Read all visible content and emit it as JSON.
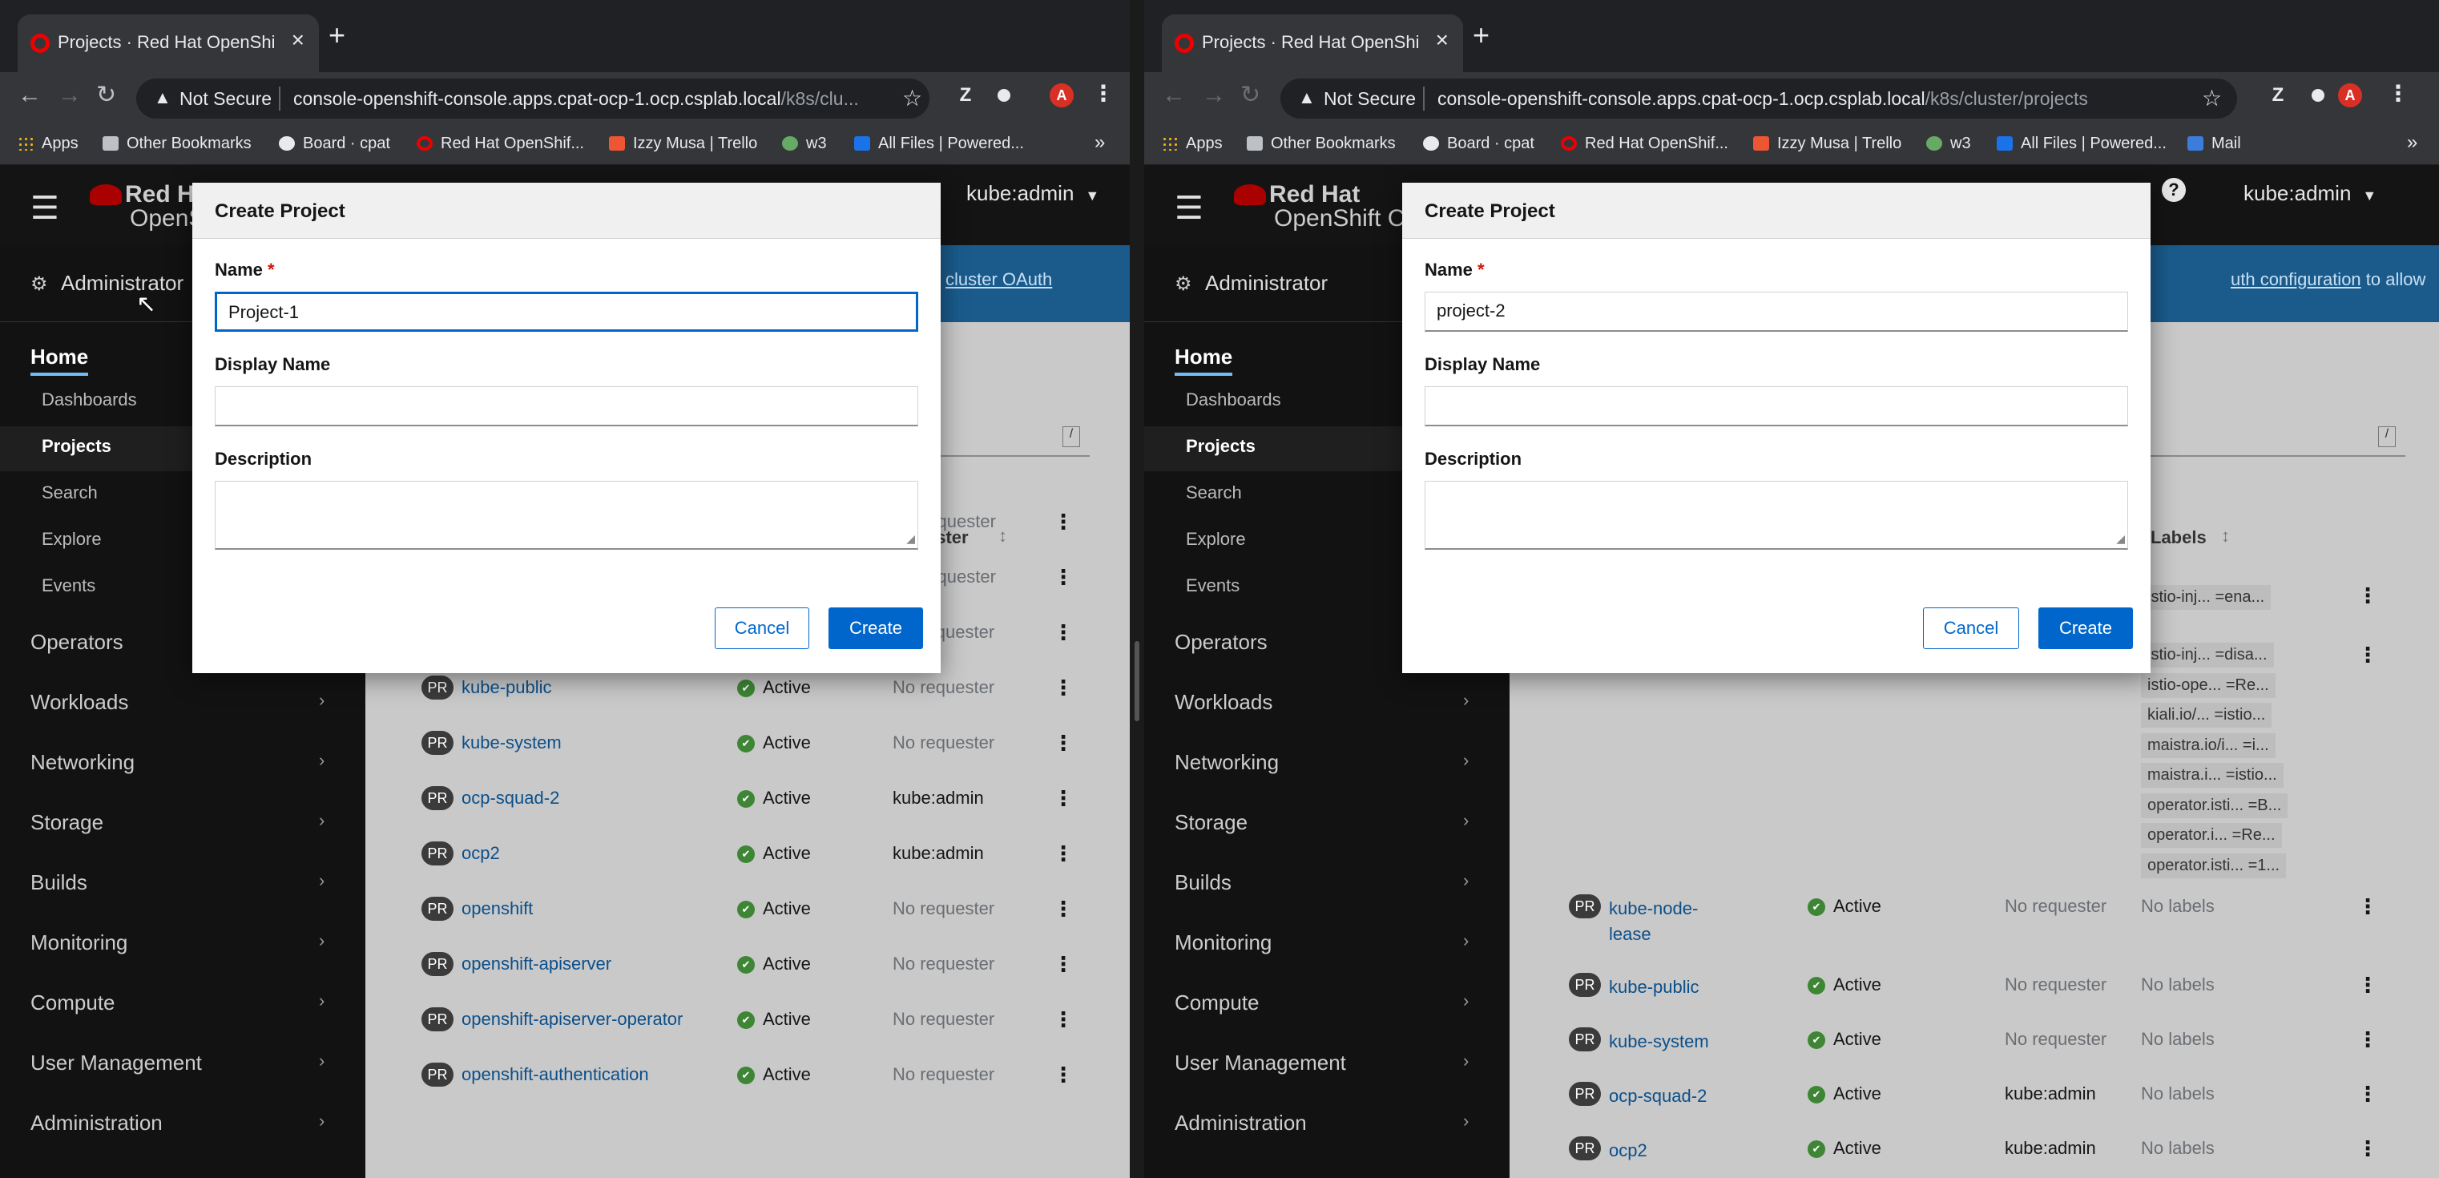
{
  "browser": {
    "tab_title": "Projects · Red Hat OpenShift C",
    "not_secure": "Not Secure",
    "left_url_main": "console-openshift-console.apps.cpat-ocp-1.ocp.csplab.local",
    "left_url_rest": "/k8s/clu...",
    "right_url_main": "console-openshift-console.apps.cpat-ocp-1.ocp.csplab.local",
    "right_url_rest": "/k8s/cluster/projects",
    "avatar_letter": "A",
    "ext_letter": "Z",
    "bookmarks": [
      "Apps",
      "Other Bookmarks",
      "Board · cpat",
      "Red Hat OpenShif...",
      "Izzy Musa | Trello",
      "w3",
      "All Files | Powered...",
      "Mail"
    ],
    "more": "»"
  },
  "console": {
    "logo_line1": "Red Hat",
    "logo_line2_left": "OpenS",
    "logo_line2_right": "OpenShift C",
    "user": "kube:admin",
    "help": "?",
    "perspective": "Administrator",
    "home": "Home",
    "home_items": [
      "Dashboards",
      "Projects",
      "Search",
      "Explore",
      "Events"
    ],
    "groups": [
      "Operators",
      "Workloads",
      "Networking",
      "Storage",
      "Builds",
      "Monitoring",
      "Compute",
      "User Management",
      "Administration"
    ],
    "banner_left": "cluster OAuth",
    "banner_right_link": "uth configuration",
    "banner_right_tail": "to allow"
  },
  "table": {
    "left_header_requester": "ester",
    "right_header_labels": "Labels",
    "slash": "/",
    "status_active": "Active",
    "left_rows": [
      {
        "name": "",
        "requester": "requester"
      },
      {
        "name": "",
        "requester": "requester"
      },
      {
        "name": "kube-node-lease",
        "requester": "No requester"
      },
      {
        "name": "kube-public",
        "requester": "No requester"
      },
      {
        "name": "kube-system",
        "requester": "No requester"
      },
      {
        "name": "ocp-squad-2",
        "requester": "kube:admin"
      },
      {
        "name": "ocp2",
        "requester": "kube:admin"
      },
      {
        "name": "openshift",
        "requester": "No requester"
      },
      {
        "name": "openshift-apiserver",
        "requester": "No requester"
      },
      {
        "name": "openshift-apiserver-operator",
        "requester": "No requester"
      },
      {
        "name": "openshift-authentication",
        "requester": "No requester"
      }
    ],
    "right_label_chips_row1": [
      "istio-inj... =ena..."
    ],
    "right_label_chips_row2": [
      "istio-inj... =disa...",
      "istio-ope... =Re...",
      "kiali.io/... =istio...",
      "maistra.io/i... =i...",
      "maistra.i... =istio...",
      "operator.isti... =B...",
      "operator.i... =Re...",
      "operator.isti... =1..."
    ],
    "right_rows": [
      {
        "name1": "kube-node-",
        "name2": "lease",
        "requester": "No requester",
        "labels": "No labels"
      },
      {
        "name1": "kube-public",
        "name2": "",
        "requester": "No requester",
        "labels": "No labels"
      },
      {
        "name1": "kube-system",
        "name2": "",
        "requester": "No requester",
        "labels": "No labels"
      },
      {
        "name1": "ocp-squad-2",
        "name2": "",
        "requester": "kube:admin",
        "labels": "No labels"
      },
      {
        "name1": "ocp2",
        "name2": "",
        "requester": "kube:admin",
        "labels": "No labels"
      }
    ],
    "badge": "PR",
    "kebab": "⋮"
  },
  "modal_left": {
    "title": "Create Project",
    "name_label": "Name",
    "name_value": "Project-1",
    "display_name_label": "Display Name",
    "display_name_value": "",
    "description_label": "Description",
    "cancel": "Cancel",
    "create": "Create"
  },
  "modal_right": {
    "title": "Create Project",
    "name_label": "Name",
    "name_value": "project-2",
    "display_name_label": "Display Name",
    "display_name_value": "",
    "description_label": "Description",
    "cancel": "Cancel",
    "create": "Create"
  },
  "colors": {
    "accent": "#0066cc",
    "link": "#0b4f8a",
    "active_status": "#3e8635",
    "redhat": "#ee0000"
  }
}
